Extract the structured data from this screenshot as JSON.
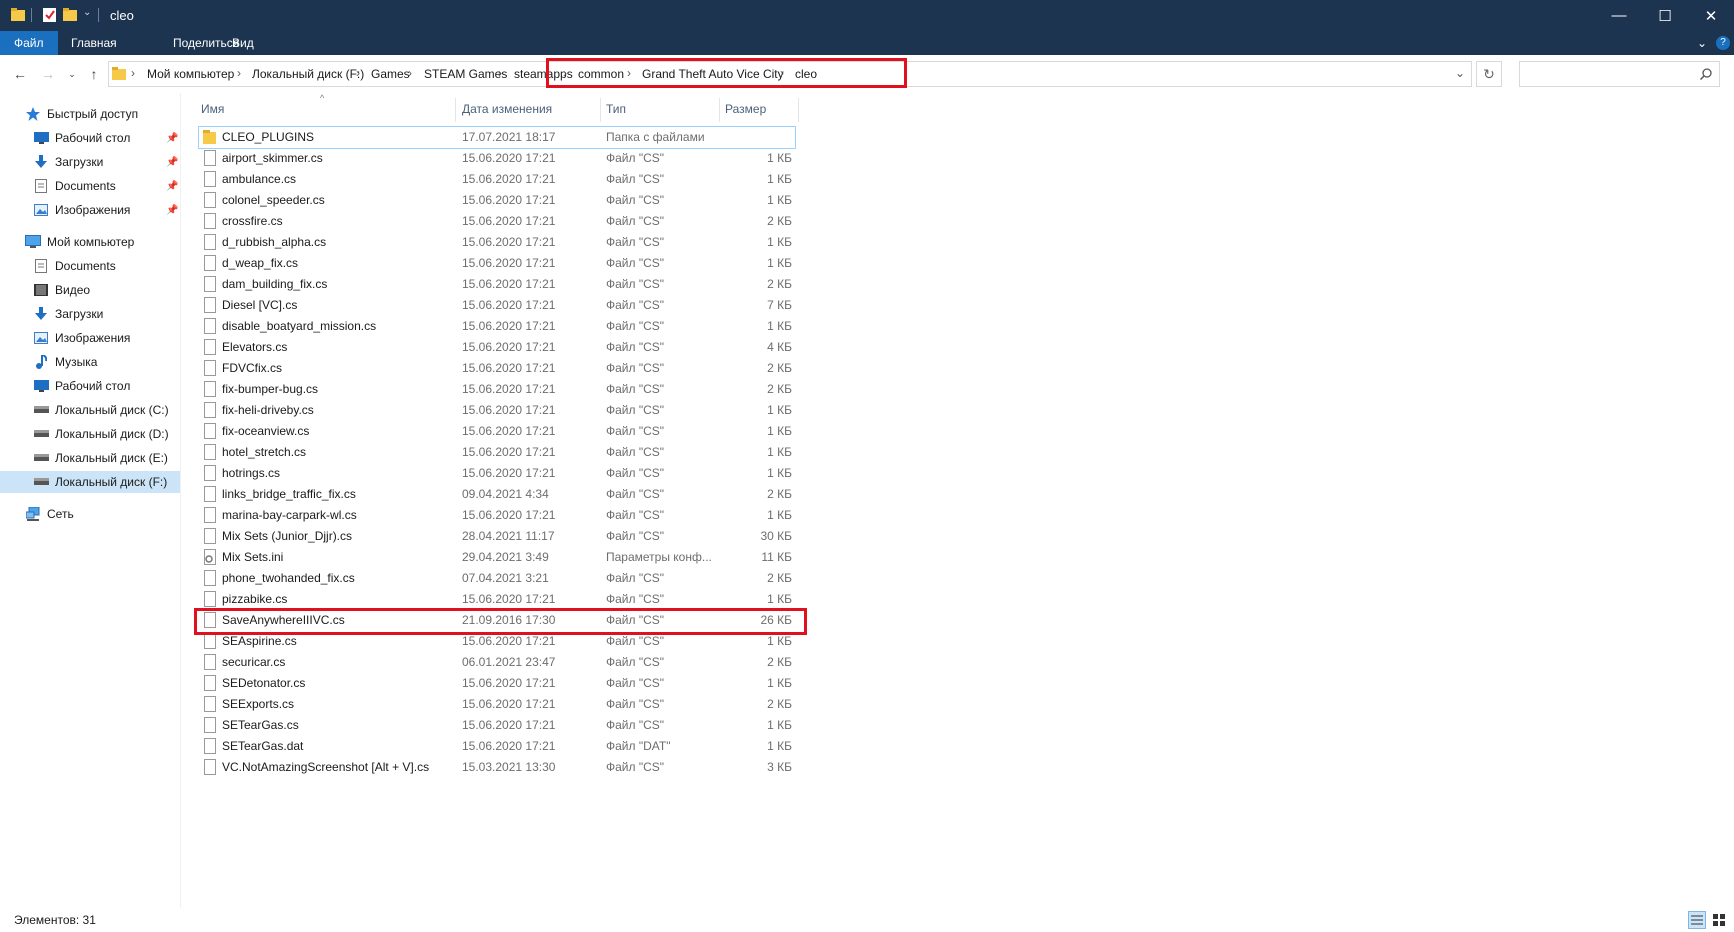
{
  "window": {
    "title": "cleo",
    "minimize_glyph": "—",
    "maximize_glyph": "☐",
    "close_glyph": "✕"
  },
  "ribbon": {
    "tabs": [
      "Файл",
      "Главная",
      "Поделиться",
      "Вид"
    ],
    "expand_glyph": "⌄",
    "help_glyph": "?"
  },
  "address": {
    "breadcrumbs": [
      "Мой компьютер",
      "Локальный диск (F:)",
      "Games",
      "STEAM Games",
      "steamapps",
      "common",
      "Grand Theft Auto Vice City",
      "cleo"
    ],
    "separator": "›",
    "search_placeholder": ""
  },
  "sidebar": {
    "items": [
      {
        "label": "Быстрый доступ",
        "icon": "star-icon",
        "pinned": false,
        "level": 0
      },
      {
        "label": "Рабочий стол",
        "icon": "desktop-icon",
        "pinned": true,
        "level": 1
      },
      {
        "label": "Загрузки",
        "icon": "download-icon",
        "pinned": true,
        "level": 1
      },
      {
        "label": "Documents",
        "icon": "documents-icon",
        "pinned": true,
        "level": 1
      },
      {
        "label": "Изображения",
        "icon": "pictures-icon",
        "pinned": true,
        "level": 1
      },
      {
        "label": "Мой компьютер",
        "icon": "computer-icon",
        "pinned": false,
        "level": 0
      },
      {
        "label": "Documents",
        "icon": "documents-icon",
        "pinned": false,
        "level": 1
      },
      {
        "label": "Видео",
        "icon": "video-icon",
        "pinned": false,
        "level": 1
      },
      {
        "label": "Загрузки",
        "icon": "download-icon",
        "pinned": false,
        "level": 1
      },
      {
        "label": "Изображения",
        "icon": "pictures-icon",
        "pinned": false,
        "level": 1
      },
      {
        "label": "Музыка",
        "icon": "music-icon",
        "pinned": false,
        "level": 1
      },
      {
        "label": "Рабочий стол",
        "icon": "desktop-icon",
        "pinned": false,
        "level": 1
      },
      {
        "label": "Локальный диск (C:)",
        "icon": "drive-icon",
        "pinned": false,
        "level": 1
      },
      {
        "label": "Локальный диск (D:)",
        "icon": "drive-icon",
        "pinned": false,
        "level": 1
      },
      {
        "label": "Локальный диск (E:)",
        "icon": "drive-icon",
        "pinned": false,
        "level": 1
      },
      {
        "label": "Локальный диск (F:)",
        "icon": "drive-icon",
        "pinned": false,
        "level": 1,
        "selected": true
      },
      {
        "label": "Сеть",
        "icon": "network-icon",
        "pinned": false,
        "level": 0
      }
    ]
  },
  "columns": [
    "Имя",
    "Дата изменения",
    "Тип",
    "Размер"
  ],
  "files": [
    {
      "name": "CLEO_PLUGINS",
      "date": "17.07.2021 18:17",
      "type": "Папка с файлами",
      "size": "",
      "kind": "folder"
    },
    {
      "name": "airport_skimmer.cs",
      "date": "15.06.2020 17:21",
      "type": "Файл \"CS\"",
      "size": "1 КБ",
      "kind": "file"
    },
    {
      "name": "ambulance.cs",
      "date": "15.06.2020 17:21",
      "type": "Файл \"CS\"",
      "size": "1 КБ",
      "kind": "file"
    },
    {
      "name": "colonel_speeder.cs",
      "date": "15.06.2020 17:21",
      "type": "Файл \"CS\"",
      "size": "1 КБ",
      "kind": "file"
    },
    {
      "name": "crossfire.cs",
      "date": "15.06.2020 17:21",
      "type": "Файл \"CS\"",
      "size": "2 КБ",
      "kind": "file"
    },
    {
      "name": "d_rubbish_alpha.cs",
      "date": "15.06.2020 17:21",
      "type": "Файл \"CS\"",
      "size": "1 КБ",
      "kind": "file"
    },
    {
      "name": "d_weap_fix.cs",
      "date": "15.06.2020 17:21",
      "type": "Файл \"CS\"",
      "size": "1 КБ",
      "kind": "file"
    },
    {
      "name": "dam_building_fix.cs",
      "date": "15.06.2020 17:21",
      "type": "Файл \"CS\"",
      "size": "2 КБ",
      "kind": "file"
    },
    {
      "name": "Diesel [VC].cs",
      "date": "15.06.2020 17:21",
      "type": "Файл \"CS\"",
      "size": "7 КБ",
      "kind": "file"
    },
    {
      "name": "disable_boatyard_mission.cs",
      "date": "15.06.2020 17:21",
      "type": "Файл \"CS\"",
      "size": "1 КБ",
      "kind": "file"
    },
    {
      "name": "Elevators.cs",
      "date": "15.06.2020 17:21",
      "type": "Файл \"CS\"",
      "size": "4 КБ",
      "kind": "file"
    },
    {
      "name": "FDVCfix.cs",
      "date": "15.06.2020 17:21",
      "type": "Файл \"CS\"",
      "size": "2 КБ",
      "kind": "file"
    },
    {
      "name": "fix-bumper-bug.cs",
      "date": "15.06.2020 17:21",
      "type": "Файл \"CS\"",
      "size": "2 КБ",
      "kind": "file"
    },
    {
      "name": "fix-heli-driveby.cs",
      "date": "15.06.2020 17:21",
      "type": "Файл \"CS\"",
      "size": "1 КБ",
      "kind": "file"
    },
    {
      "name": "fix-oceanview.cs",
      "date": "15.06.2020 17:21",
      "type": "Файл \"CS\"",
      "size": "1 КБ",
      "kind": "file"
    },
    {
      "name": "hotel_stretch.cs",
      "date": "15.06.2020 17:21",
      "type": "Файл \"CS\"",
      "size": "1 КБ",
      "kind": "file"
    },
    {
      "name": "hotrings.cs",
      "date": "15.06.2020 17:21",
      "type": "Файл \"CS\"",
      "size": "1 КБ",
      "kind": "file"
    },
    {
      "name": "links_bridge_traffic_fix.cs",
      "date": "09.04.2021 4:34",
      "type": "Файл \"CS\"",
      "size": "2 КБ",
      "kind": "file"
    },
    {
      "name": "marina-bay-carpark-wl.cs",
      "date": "15.06.2020 17:21",
      "type": "Файл \"CS\"",
      "size": "1 КБ",
      "kind": "file"
    },
    {
      "name": "Mix Sets (Junior_Djjr).cs",
      "date": "28.04.2021 11:17",
      "type": "Файл \"CS\"",
      "size": "30 КБ",
      "kind": "file"
    },
    {
      "name": "Mix Sets.ini",
      "date": "29.04.2021 3:49",
      "type": "Параметры конф...",
      "size": "11 КБ",
      "kind": "ini"
    },
    {
      "name": "phone_twohanded_fix.cs",
      "date": "07.04.2021 3:21",
      "type": "Файл \"CS\"",
      "size": "2 КБ",
      "kind": "file"
    },
    {
      "name": "pizzabike.cs",
      "date": "15.06.2020 17:21",
      "type": "Файл \"CS\"",
      "size": "1 КБ",
      "kind": "file"
    },
    {
      "name": "SaveAnywhereIIIVC.cs",
      "date": "21.09.2016 17:30",
      "type": "Файл \"CS\"",
      "size": "26 КБ",
      "kind": "file",
      "highlighted": true
    },
    {
      "name": "SEAspirine.cs",
      "date": "15.06.2020 17:21",
      "type": "Файл \"CS\"",
      "size": "1 КБ",
      "kind": "file"
    },
    {
      "name": "securicar.cs",
      "date": "06.01.2021 23:47",
      "type": "Файл \"CS\"",
      "size": "2 КБ",
      "kind": "file"
    },
    {
      "name": "SEDetonator.cs",
      "date": "15.06.2020 17:21",
      "type": "Файл \"CS\"",
      "size": "1 КБ",
      "kind": "file"
    },
    {
      "name": "SEExports.cs",
      "date": "15.06.2020 17:21",
      "type": "Файл \"CS\"",
      "size": "2 КБ",
      "kind": "file"
    },
    {
      "name": "SETearGas.cs",
      "date": "15.06.2020 17:21",
      "type": "Файл \"CS\"",
      "size": "1 КБ",
      "kind": "file"
    },
    {
      "name": "SETearGas.dat",
      "date": "15.06.2020 17:21",
      "type": "Файл \"DAT\"",
      "size": "1 КБ",
      "kind": "file"
    },
    {
      "name": "VC.NotAmazingScreenshot [Alt + V].cs",
      "date": "15.03.2021 13:30",
      "type": "Файл \"CS\"",
      "size": "3 КБ",
      "kind": "file"
    }
  ],
  "status": {
    "item_count": "Элементов: 31"
  },
  "colors": {
    "titlebar": "#1c3450",
    "active_tab": "#1a6fbf",
    "highlight": "#e0101f",
    "selection": "#cce4f7"
  }
}
